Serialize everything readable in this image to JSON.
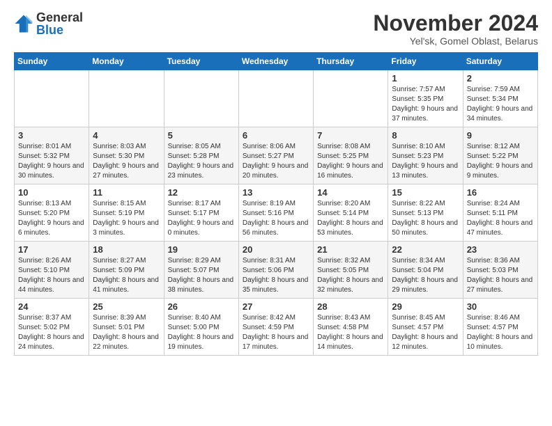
{
  "logo": {
    "general": "General",
    "blue": "Blue"
  },
  "header": {
    "month": "November 2024",
    "location": "Yel'sk, Gomel Oblast, Belarus"
  },
  "weekdays": [
    "Sunday",
    "Monday",
    "Tuesday",
    "Wednesday",
    "Thursday",
    "Friday",
    "Saturday"
  ],
  "weeks": [
    [
      {
        "day": "",
        "info": ""
      },
      {
        "day": "",
        "info": ""
      },
      {
        "day": "",
        "info": ""
      },
      {
        "day": "",
        "info": ""
      },
      {
        "day": "",
        "info": ""
      },
      {
        "day": "1",
        "info": "Sunrise: 7:57 AM\nSunset: 5:35 PM\nDaylight: 9 hours and 37 minutes."
      },
      {
        "day": "2",
        "info": "Sunrise: 7:59 AM\nSunset: 5:34 PM\nDaylight: 9 hours and 34 minutes."
      }
    ],
    [
      {
        "day": "3",
        "info": "Sunrise: 8:01 AM\nSunset: 5:32 PM\nDaylight: 9 hours and 30 minutes."
      },
      {
        "day": "4",
        "info": "Sunrise: 8:03 AM\nSunset: 5:30 PM\nDaylight: 9 hours and 27 minutes."
      },
      {
        "day": "5",
        "info": "Sunrise: 8:05 AM\nSunset: 5:28 PM\nDaylight: 9 hours and 23 minutes."
      },
      {
        "day": "6",
        "info": "Sunrise: 8:06 AM\nSunset: 5:27 PM\nDaylight: 9 hours and 20 minutes."
      },
      {
        "day": "7",
        "info": "Sunrise: 8:08 AM\nSunset: 5:25 PM\nDaylight: 9 hours and 16 minutes."
      },
      {
        "day": "8",
        "info": "Sunrise: 8:10 AM\nSunset: 5:23 PM\nDaylight: 9 hours and 13 minutes."
      },
      {
        "day": "9",
        "info": "Sunrise: 8:12 AM\nSunset: 5:22 PM\nDaylight: 9 hours and 9 minutes."
      }
    ],
    [
      {
        "day": "10",
        "info": "Sunrise: 8:13 AM\nSunset: 5:20 PM\nDaylight: 9 hours and 6 minutes."
      },
      {
        "day": "11",
        "info": "Sunrise: 8:15 AM\nSunset: 5:19 PM\nDaylight: 9 hours and 3 minutes."
      },
      {
        "day": "12",
        "info": "Sunrise: 8:17 AM\nSunset: 5:17 PM\nDaylight: 9 hours and 0 minutes."
      },
      {
        "day": "13",
        "info": "Sunrise: 8:19 AM\nSunset: 5:16 PM\nDaylight: 8 hours and 56 minutes."
      },
      {
        "day": "14",
        "info": "Sunrise: 8:20 AM\nSunset: 5:14 PM\nDaylight: 8 hours and 53 minutes."
      },
      {
        "day": "15",
        "info": "Sunrise: 8:22 AM\nSunset: 5:13 PM\nDaylight: 8 hours and 50 minutes."
      },
      {
        "day": "16",
        "info": "Sunrise: 8:24 AM\nSunset: 5:11 PM\nDaylight: 8 hours and 47 minutes."
      }
    ],
    [
      {
        "day": "17",
        "info": "Sunrise: 8:26 AM\nSunset: 5:10 PM\nDaylight: 8 hours and 44 minutes."
      },
      {
        "day": "18",
        "info": "Sunrise: 8:27 AM\nSunset: 5:09 PM\nDaylight: 8 hours and 41 minutes."
      },
      {
        "day": "19",
        "info": "Sunrise: 8:29 AM\nSunset: 5:07 PM\nDaylight: 8 hours and 38 minutes."
      },
      {
        "day": "20",
        "info": "Sunrise: 8:31 AM\nSunset: 5:06 PM\nDaylight: 8 hours and 35 minutes."
      },
      {
        "day": "21",
        "info": "Sunrise: 8:32 AM\nSunset: 5:05 PM\nDaylight: 8 hours and 32 minutes."
      },
      {
        "day": "22",
        "info": "Sunrise: 8:34 AM\nSunset: 5:04 PM\nDaylight: 8 hours and 29 minutes."
      },
      {
        "day": "23",
        "info": "Sunrise: 8:36 AM\nSunset: 5:03 PM\nDaylight: 8 hours and 27 minutes."
      }
    ],
    [
      {
        "day": "24",
        "info": "Sunrise: 8:37 AM\nSunset: 5:02 PM\nDaylight: 8 hours and 24 minutes."
      },
      {
        "day": "25",
        "info": "Sunrise: 8:39 AM\nSunset: 5:01 PM\nDaylight: 8 hours and 22 minutes."
      },
      {
        "day": "26",
        "info": "Sunrise: 8:40 AM\nSunset: 5:00 PM\nDaylight: 8 hours and 19 minutes."
      },
      {
        "day": "27",
        "info": "Sunrise: 8:42 AM\nSunset: 4:59 PM\nDaylight: 8 hours and 17 minutes."
      },
      {
        "day": "28",
        "info": "Sunrise: 8:43 AM\nSunset: 4:58 PM\nDaylight: 8 hours and 14 minutes."
      },
      {
        "day": "29",
        "info": "Sunrise: 8:45 AM\nSunset: 4:57 PM\nDaylight: 8 hours and 12 minutes."
      },
      {
        "day": "30",
        "info": "Sunrise: 8:46 AM\nSunset: 4:57 PM\nDaylight: 8 hours and 10 minutes."
      }
    ]
  ]
}
